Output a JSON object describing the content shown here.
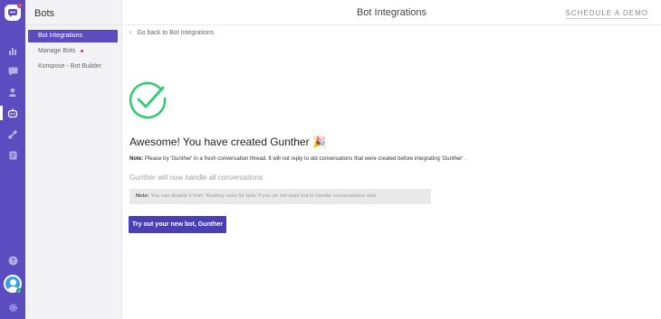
{
  "sidebar": {
    "title": "Bots",
    "items": [
      {
        "label": "Bot Integrations"
      },
      {
        "label": "Manage Bots"
      },
      {
        "label": "Kompose - Bot Builder"
      }
    ]
  },
  "header": {
    "title": "Bot Integrations",
    "demo_link": "SCHEDULE A DEMO"
  },
  "main": {
    "back_link": "Go back to Bot Integrations",
    "success_title": "Awesome! You have created Gunther",
    "party_emoji": "🎉",
    "note_label": "Note:",
    "note_text": "Please try 'Gunther' in a fresh conversation thread. It will not reply to old conversations that were created before integrating 'Gunther' .",
    "handle_text": "Gunther will now handle all conversations",
    "info_label": "Note:",
    "info_text": "You can disable it from 'Routing rules for bots' if you do not want bot to handle conversations now",
    "cta_label": "Try out your new bot, Gunther"
  },
  "colors": {
    "brand": "#5b4dc0",
    "button": "#4b3fb5",
    "success": "#2ecc71",
    "alert_dot": "#e53935"
  },
  "icons": {
    "rail": [
      "logo-chat-icon",
      "reports-icon",
      "conversations-icon",
      "contacts-icon",
      "bot-icon",
      "integrations-icon",
      "docs-icon",
      "help-icon",
      "user-avatar",
      "settings-icon"
    ]
  }
}
